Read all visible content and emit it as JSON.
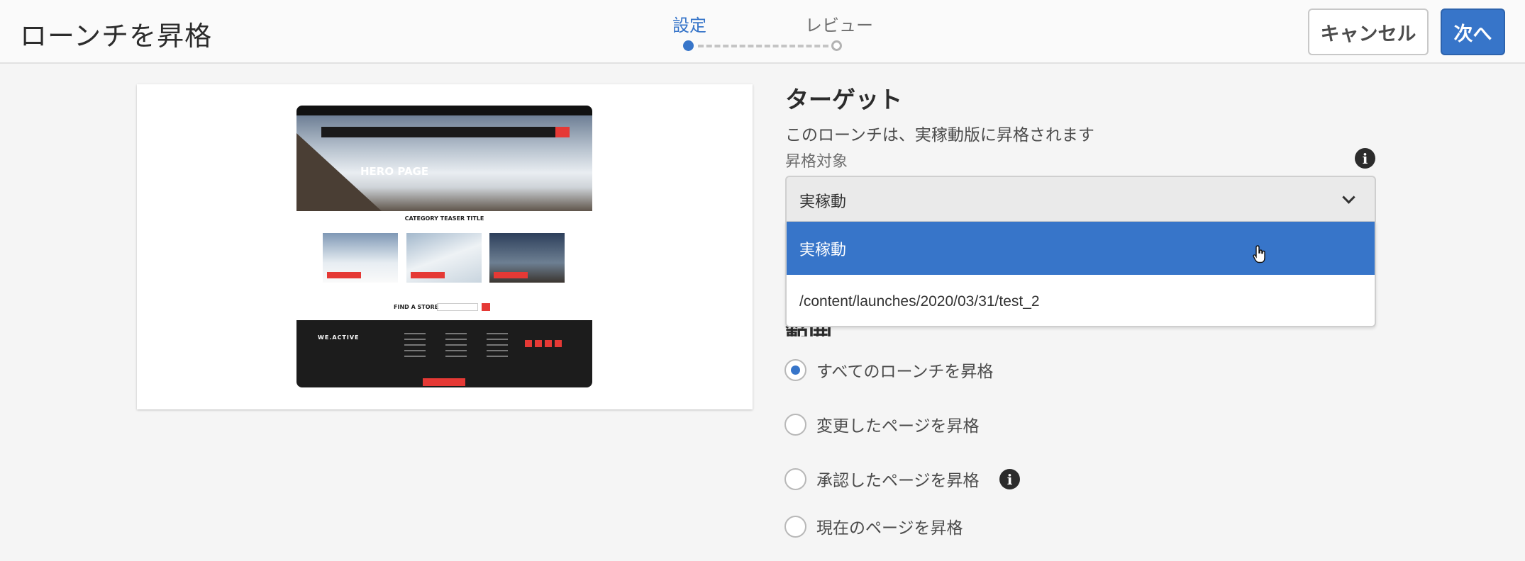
{
  "header": {
    "title": "ローンチを昇格",
    "steps": [
      {
        "label": "設定",
        "active": true
      },
      {
        "label": "レビュー",
        "active": false
      }
    ],
    "cancel_label": "キャンセル",
    "next_label": "次へ"
  },
  "preview": {
    "hero_title": "HERO PAGE",
    "category_title": "CATEGORY TEASER TITLE",
    "find_store": "FIND A STORE",
    "logo": "WE.ACTIVE"
  },
  "target": {
    "title": "ターゲット",
    "description": "このローンチは、実稼動版に昇格されます",
    "field_label": "昇格対象",
    "selected": "実稼動",
    "options": [
      "実稼動",
      "/content/launches/2020/03/31/test_2"
    ]
  },
  "scope": {
    "title": "範囲",
    "options": [
      {
        "label": "すべてのローンチを昇格",
        "checked": true
      },
      {
        "label": "変更したページを昇格",
        "checked": false
      },
      {
        "label": "承認したページを昇格",
        "checked": false
      },
      {
        "label": "現在のページを昇格",
        "checked": false
      }
    ]
  },
  "colors": {
    "accent": "#3775c9",
    "header_bg": "#fafafa",
    "page_bg": "#f5f5f5"
  },
  "icons": [
    "info-icon",
    "chevron-down-icon",
    "hand-cursor-icon"
  ]
}
